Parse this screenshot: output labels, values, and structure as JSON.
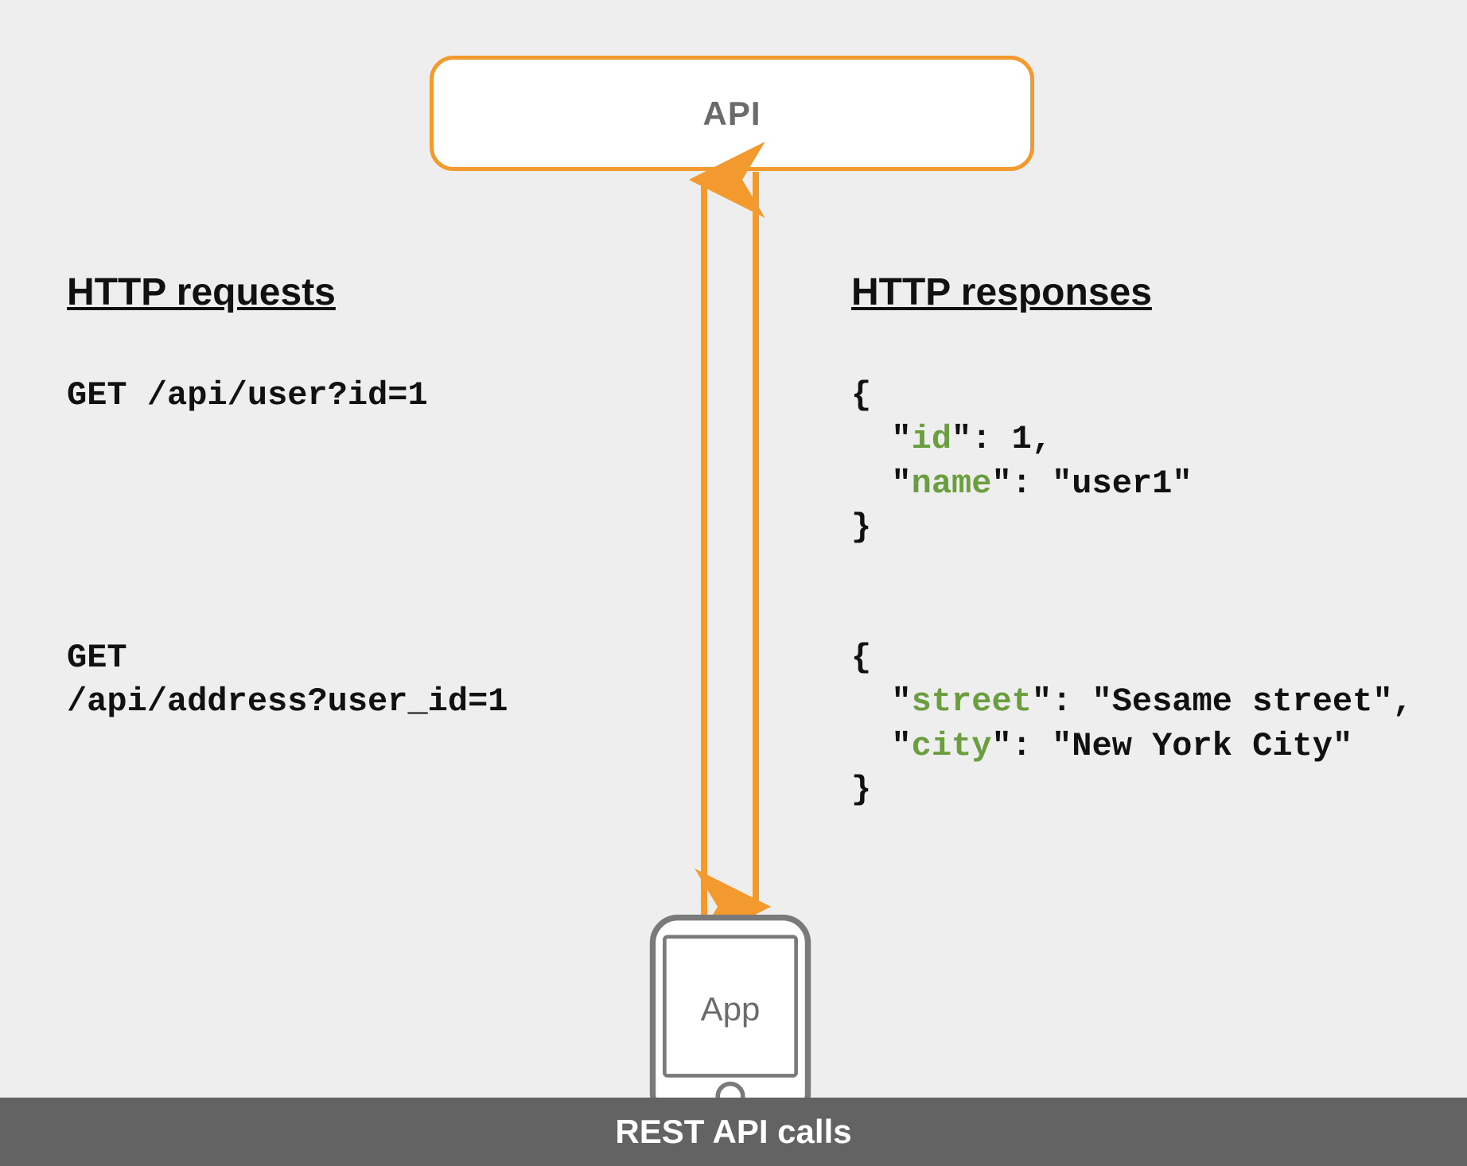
{
  "diagram": {
    "api_label": "API",
    "app_label": "App",
    "requests_heading": "HTTP requests",
    "responses_heading": "HTTP responses",
    "footer": "REST API calls",
    "requests": [
      {
        "method": "GET",
        "path": "/api/user?id=1"
      },
      {
        "method": "GET",
        "path": "/api/address?user_id=1"
      }
    ],
    "responses": [
      {
        "fields": [
          {
            "key": "id",
            "value": "1",
            "quoted": false
          },
          {
            "key": "name",
            "value": "user1",
            "quoted": true
          }
        ]
      },
      {
        "fields": [
          {
            "key": "street",
            "value": "Sesame street",
            "quoted": true
          },
          {
            "key": "city",
            "value": "New York City",
            "quoted": true
          }
        ]
      }
    ],
    "colors": {
      "accent": "#f29a2e",
      "json_key": "#6a9e3f",
      "footer_bg": "#636363",
      "canvas_bg": "#eeeeee",
      "node_text": "#6b6b6b"
    }
  }
}
